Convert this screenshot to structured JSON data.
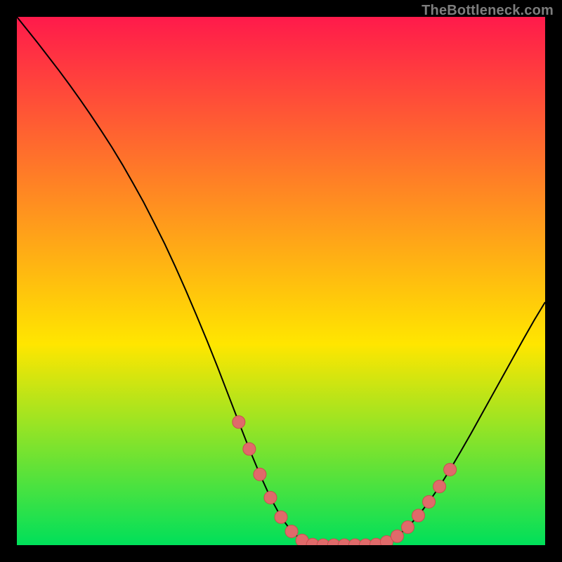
{
  "watermark": "TheBottleneck.com",
  "colors": {
    "grad_top": "#ff1a4b",
    "grad_mid": "#ffe600",
    "grad_bot": "#00e05a",
    "curve_stroke": "#000000",
    "dot_fill": "#e06a6a",
    "dot_stroke": "#c94f4f",
    "background": "#000000"
  },
  "chart_data": {
    "type": "line",
    "title": "",
    "xlabel": "",
    "ylabel": "",
    "xlim": [
      0,
      100
    ],
    "ylim": [
      0,
      100
    ],
    "x": [
      0,
      2,
      4,
      6,
      8,
      10,
      12,
      14,
      16,
      18,
      20,
      22,
      24,
      26,
      28,
      30,
      32,
      34,
      36,
      38,
      40,
      42,
      44,
      46,
      48,
      50,
      52,
      54,
      56,
      58,
      60,
      62,
      64,
      66,
      68,
      70,
      72,
      74,
      76,
      78,
      80,
      82,
      84,
      86,
      88,
      90,
      92,
      94,
      96,
      98,
      100
    ],
    "values": [
      100,
      97.5,
      95,
      92.4,
      89.8,
      87.1,
      84.3,
      81.4,
      78.4,
      75.3,
      72,
      68.5,
      64.9,
      61,
      57,
      52.7,
      48.2,
      43.5,
      38.7,
      33.7,
      28.5,
      23.3,
      18.2,
      13.4,
      9,
      5.3,
      2.6,
      0.9,
      0.1,
      0,
      0,
      0,
      0,
      0,
      0.1,
      0.6,
      1.7,
      3.4,
      5.6,
      8.2,
      11.1,
      14.3,
      17.7,
      21.2,
      24.8,
      28.4,
      32,
      35.6,
      39.2,
      42.7,
      46
    ],
    "series": [
      {
        "name": "bottleneck-curve",
        "kind": "curve"
      },
      {
        "name": "highlight-dots",
        "kind": "dots",
        "points": [
          {
            "x": 42,
            "y": 23.3
          },
          {
            "x": 44,
            "y": 18.2
          },
          {
            "x": 46,
            "y": 13.4
          },
          {
            "x": 48,
            "y": 9.0
          },
          {
            "x": 50,
            "y": 5.3
          },
          {
            "x": 52,
            "y": 2.6
          },
          {
            "x": 54,
            "y": 0.9
          },
          {
            "x": 56,
            "y": 0.1
          },
          {
            "x": 58,
            "y": 0.0
          },
          {
            "x": 60,
            "y": 0.0
          },
          {
            "x": 62,
            "y": 0.0
          },
          {
            "x": 64,
            "y": 0.0
          },
          {
            "x": 66,
            "y": 0.0
          },
          {
            "x": 68,
            "y": 0.1
          },
          {
            "x": 70,
            "y": 0.6
          },
          {
            "x": 72,
            "y": 1.7
          },
          {
            "x": 74,
            "y": 3.4
          },
          {
            "x": 76,
            "y": 5.6
          },
          {
            "x": 78,
            "y": 8.2
          },
          {
            "x": 80,
            "y": 11.1
          },
          {
            "x": 82,
            "y": 14.3
          }
        ]
      }
    ]
  }
}
